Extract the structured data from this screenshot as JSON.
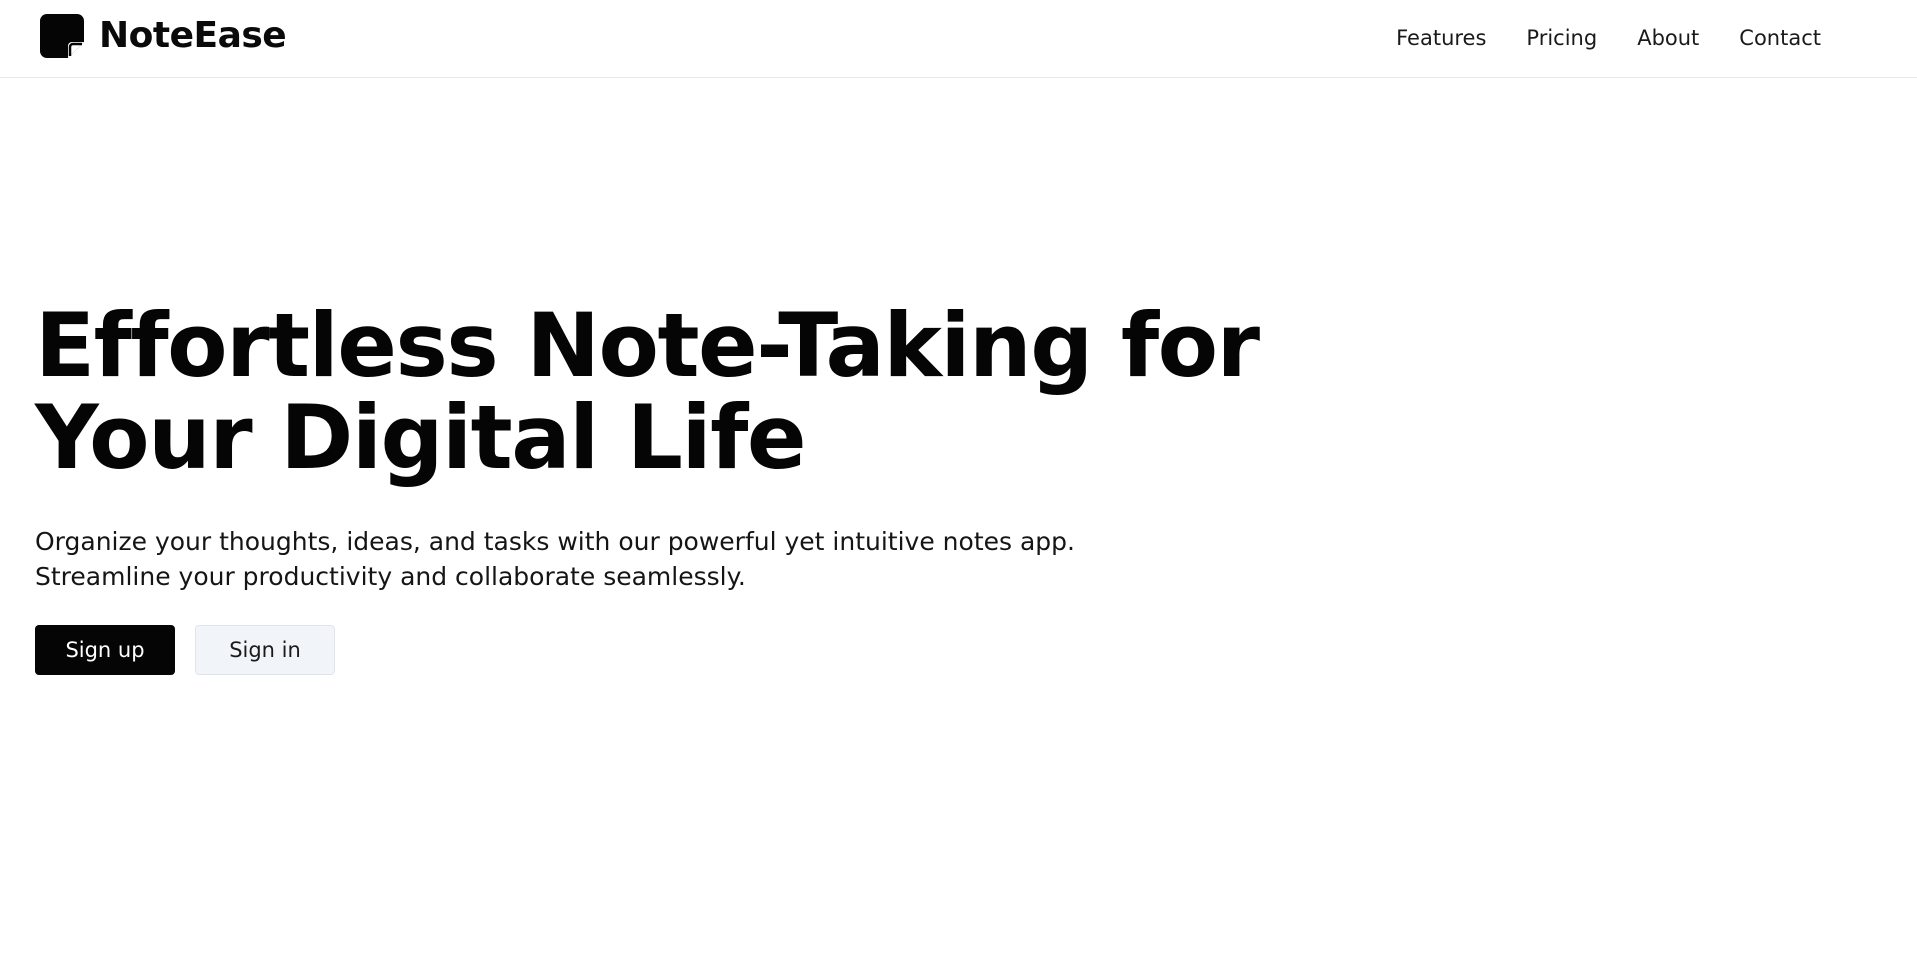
{
  "header": {
    "brand_name": "NoteEase",
    "logo_icon": "sticky-note-icon",
    "nav": [
      {
        "label": "Features"
      },
      {
        "label": "Pricing"
      },
      {
        "label": "About"
      },
      {
        "label": "Contact"
      }
    ]
  },
  "hero": {
    "title": "Effortless Note-Taking for Your Digital Life",
    "subtitle_line1": "Organize your thoughts, ideas, and tasks with our powerful yet intuitive notes app.",
    "subtitle_line2": "Streamline your productivity and collaborate seamlessly.",
    "primary_button": "Sign up",
    "secondary_button": "Sign in"
  },
  "colors": {
    "text": "#050505",
    "primary_button_bg": "#050505",
    "secondary_button_bg": "#f1f4f8",
    "header_border": "#e8e8e8"
  }
}
